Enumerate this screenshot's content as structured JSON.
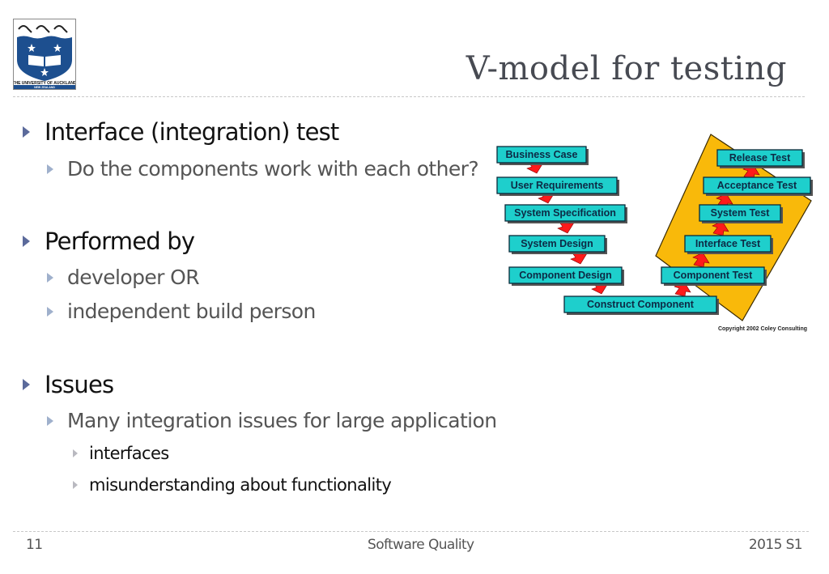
{
  "logo": {
    "name": "THE UNIVERSITY OF AUCKLAND",
    "subtitle": "NEW ZEALAND"
  },
  "slide": {
    "title": "V-model for testing",
    "bullets": [
      {
        "level": 1,
        "text": "Interface (integration) test"
      },
      {
        "level": 2,
        "text": "Do the components work with each other?"
      },
      {
        "level": 1,
        "text": "Performed by"
      },
      {
        "level": 2,
        "text": "developer OR"
      },
      {
        "level": 2,
        "text": "independent build person"
      },
      {
        "level": 1,
        "text": "Issues"
      },
      {
        "level": 2,
        "text": "Many integration issues for large application"
      },
      {
        "level": 3,
        "text": "interfaces"
      },
      {
        "level": 3,
        "text": "misunderstanding about functionality"
      }
    ]
  },
  "diagram": {
    "left_side": [
      "Business Case",
      "User Requirements",
      "System Specification",
      "System Design",
      "Component Design"
    ],
    "bottom": "Construct Component",
    "right_side": [
      "Component Test",
      "Interface Test",
      "System Test",
      "Acceptance Test",
      "Release Test"
    ],
    "copyright": "Copyright 2002 Coley Consulting",
    "colors": {
      "box_fill": "#1ecfcc",
      "box_border": "#0a2a3a",
      "arrow": "#ff1a1a",
      "band": "#f9b90a",
      "shadow": "#555555"
    }
  },
  "footer": {
    "page_number": "11",
    "course": "Software Quality",
    "term": "2015 S1"
  }
}
